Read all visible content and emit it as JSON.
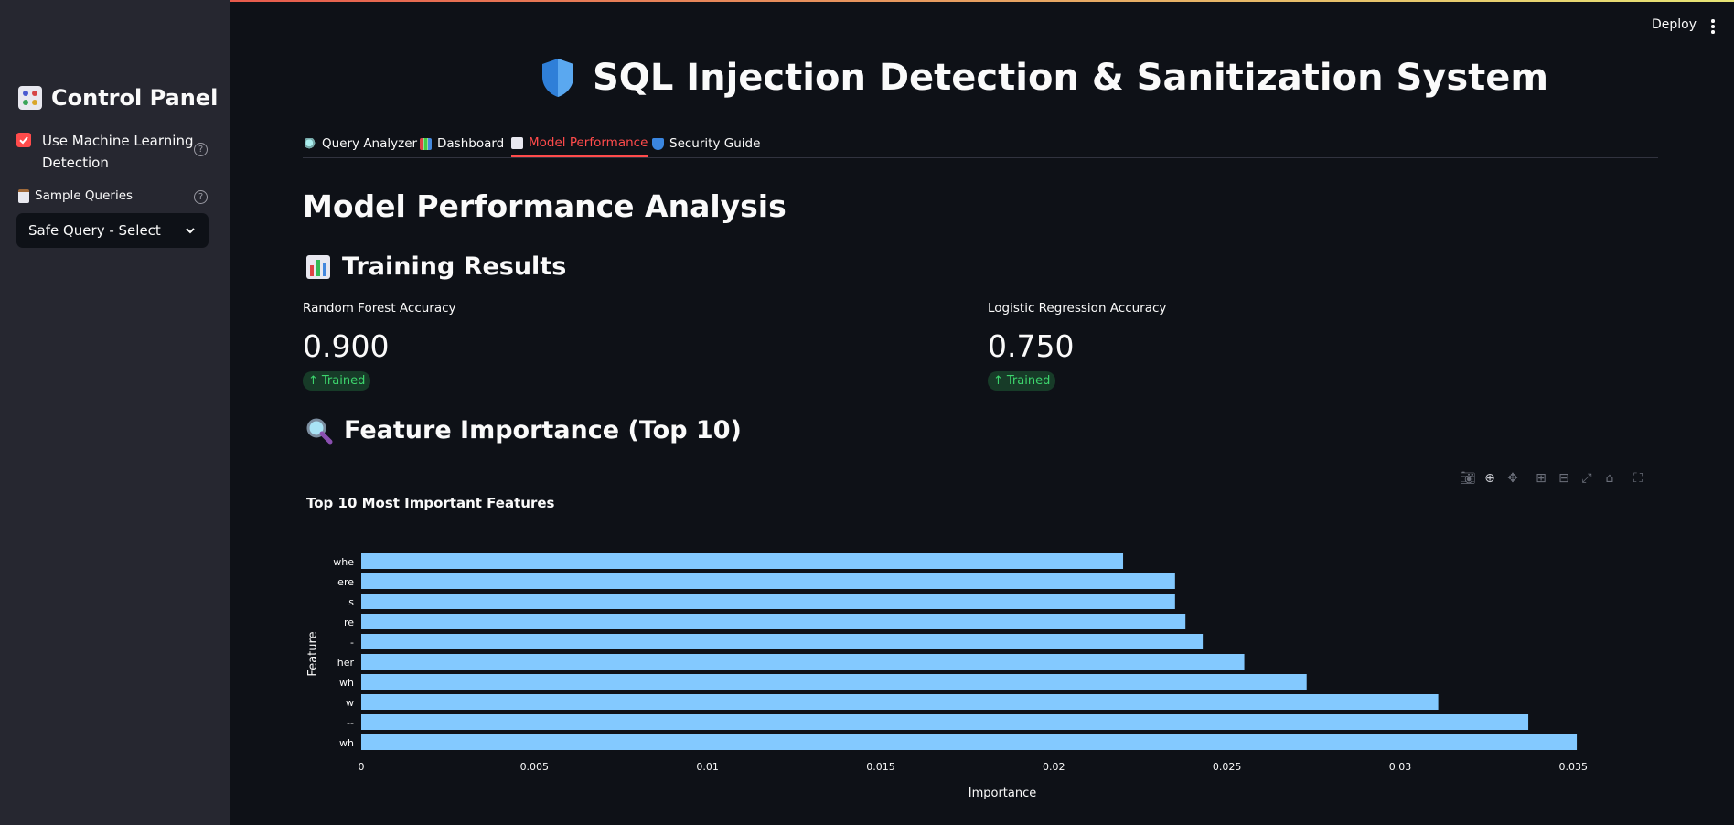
{
  "sidebar": {
    "title": "Control Panel",
    "title_icon": "control-knobs-icon",
    "ml_checkbox": {
      "label_line1": "Use Machine Learning",
      "label_line2": "Detection",
      "checked": true
    },
    "sample_queries": {
      "label": "Sample Queries",
      "selected": "Safe Query - Select"
    }
  },
  "header": {
    "deploy": "Deploy"
  },
  "app": {
    "title": "SQL Injection Detection & Sanitization System",
    "title_icon": "shield-icon"
  },
  "tabs": [
    {
      "label": "Query Analyzer",
      "icon": "magnifier-icon",
      "active": false
    },
    {
      "label": "Dashboard",
      "icon": "bar-chart-icon",
      "active": false
    },
    {
      "label": "Model Performance",
      "icon": "line-chart-icon",
      "active": true
    },
    {
      "label": "Security Guide",
      "icon": "shield-icon",
      "active": false
    }
  ],
  "page": {
    "heading": "Model Performance Analysis",
    "training_heading": "Training Results",
    "feature_heading": "Feature Importance (Top 10)"
  },
  "metrics": [
    {
      "label": "Random Forest Accuracy",
      "value": "0.900",
      "delta": "Trained"
    },
    {
      "label": "Logistic Regression Accuracy",
      "value": "0.750",
      "delta": "Trained"
    }
  ],
  "colors": {
    "accent": "#ff4b4b",
    "bar": "#83c9ff",
    "delta_text": "#3dd56d"
  },
  "chart_data": {
    "type": "bar",
    "orientation": "horizontal",
    "title": "Top 10 Most Important Features",
    "xlabel": "Importance",
    "ylabel": "Feature",
    "categories": [
      "whe",
      "ere",
      "s",
      "re",
      "-",
      "her",
      "wh",
      "w",
      "--",
      "wh"
    ],
    "values": [
      0.022,
      0.0235,
      0.0235,
      0.0238,
      0.0243,
      0.0255,
      0.0273,
      0.0311,
      0.0337,
      0.0351
    ],
    "xlim": [
      0,
      0.0356
    ],
    "xticks": [
      "0",
      "0.005",
      "0.01",
      "0.015",
      "0.02",
      "0.025",
      "0.03",
      "0.035"
    ],
    "grid": false
  }
}
